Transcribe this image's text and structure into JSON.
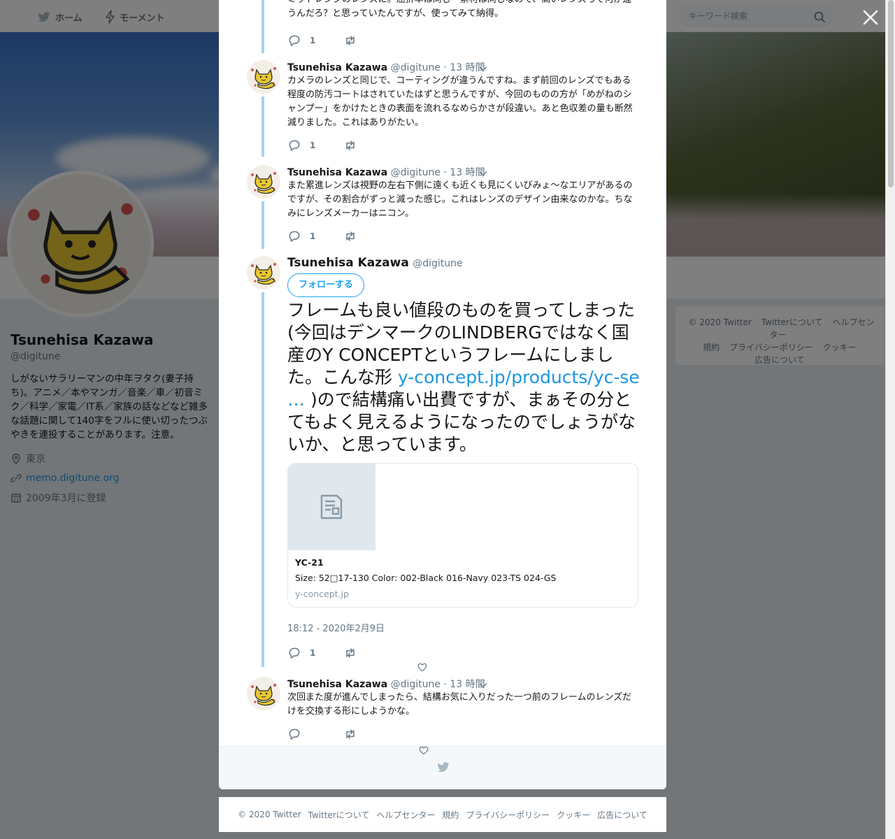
{
  "topnav": {
    "home_label": "ホーム",
    "moments_label": "モーメント"
  },
  "search": {
    "placeholder": "キーワード検索"
  },
  "profile": {
    "name": "Tsunehisa Kazawa",
    "handle": "@digitune",
    "bio": "しがないサラリーマンの中年ヲタク(妻子持ち)。アニメ／本やマンガ／音楽／車／初音ミク／科学／家電／IT系／家族の話などなど雑多な話題に関して140字をフルに使い切ったつぶやきを連投することがあります。注意。",
    "location": "東京",
    "website": "memo.digitune.org",
    "joined": "2009年3月に登録"
  },
  "side_footer": {
    "items": [
      "© 2020 Twitter",
      "Twitterについて",
      "ヘルプセンター",
      "規約",
      "プライバシーポリシー",
      "クッキー",
      "広告について"
    ]
  },
  "thread": {
    "top_partial_text": "ミッドレンジのレンズに。屈折率は同じ＝素材は同じなので、高いレンズって何が違うんだろ？と思っていたんですが、使ってみて納得。",
    "top_partial_reply_count": "1",
    "tweets": [
      {
        "name": "Tsunehisa Kazawa",
        "handle": "@digitune",
        "time": "· 13 時間",
        "text": "カメラのレンズと同じで、コーティングが違うんですね。まず前回のレンズでもある程度の防汚コートはされていたはずと思うんですが、今回のものの方が「めがねのシャンプー」をかけたときの表面を流れるなめらかさが段違い。あと色収差の量も断然減りました。これはありがたい。",
        "reply_count": "1"
      },
      {
        "name": "Tsunehisa Kazawa",
        "handle": "@digitune",
        "time": "· 13 時間",
        "text": "また累進レンズは視野の左右下側に遠くも近くも見にくいびみょ〜なエリアがあるのですが、その割合がずっと減った感じ。これはレンズのデザイン由来なのかな。ちなみにレンズメーカーはニコン。",
        "reply_count": "1"
      }
    ],
    "main": {
      "name": "Tsunehisa Kazawa",
      "handle": "@digitune",
      "follow_label": "フォローする",
      "text_before": "フレームも良い値段のものを買ってしまった(今回はデンマークのLINDBERGではなく国産のY CONCEPTというフレームにしました。こんな形 ",
      "link": "y-concept.jp/products/yc-se …",
      "text_after": " )ので結構痛い出費ですが、まぁその分とてもよく見えるようになったのでしょうがないか、と思っています。",
      "card": {
        "title": "YC-21",
        "description": "Size: 52□17-130 Color: 002-Black 016-Navy 023-TS 024-GS",
        "domain": "y-concept.jp"
      },
      "date": "18:12 - 2020年2月9日",
      "reply_count": "1"
    },
    "last": {
      "name": "Tsunehisa Kazawa",
      "handle": "@digitune",
      "time": "· 13 時間",
      "text": "次回また度が進んでしまったら、結構お気に入りだった一つ前のフレームのレンズだけを交換する形にしようかな。"
    }
  },
  "bottom_footer": {
    "items": [
      "© 2020 Twitter",
      "Twitterについて",
      "ヘルプセンター",
      "規約",
      "プライバシーポリシー",
      "クッキー",
      "広告について"
    ]
  },
  "colors": {
    "accent": "#1da1f2",
    "link": "#1b95e0",
    "thread_line": "#9fd3f7",
    "muted": "#657786"
  }
}
